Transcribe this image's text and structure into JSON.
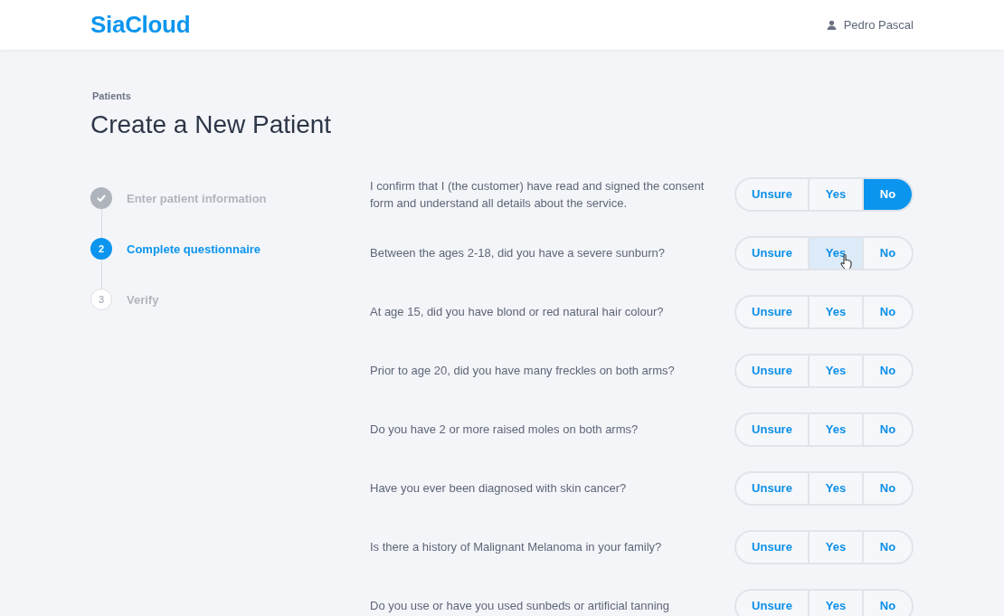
{
  "header": {
    "logo": "SiaCloud",
    "user": "Pedro Pascal"
  },
  "breadcrumb": "Patients",
  "title": "Create a New Patient",
  "steps": [
    {
      "label": "Enter patient information",
      "kind": "done"
    },
    {
      "marker": "2",
      "label": "Complete questionnaire",
      "kind": "current"
    },
    {
      "marker": "3",
      "label": "Verify",
      "kind": "pending"
    }
  ],
  "questions": [
    {
      "text": "I confirm that I (the customer) have read and signed the consent form and understand all details about the service.",
      "options": [
        {
          "label": "Unsure",
          "selected": false,
          "hovered": false
        },
        {
          "label": "Yes",
          "selected": false,
          "hovered": false
        },
        {
          "label": "No",
          "selected": true,
          "hovered": false
        }
      ]
    },
    {
      "text": "Between the ages 2-18, did you have a severe sunburn?",
      "options": [
        {
          "label": "Unsure",
          "selected": false,
          "hovered": false
        },
        {
          "label": "Yes",
          "selected": false,
          "hovered": true
        },
        {
          "label": "No",
          "selected": false,
          "hovered": false
        }
      ]
    },
    {
      "text": "At age 15, did you have blond or red natural hair colour?",
      "options": [
        {
          "label": "Unsure",
          "selected": false,
          "hovered": false
        },
        {
          "label": "Yes",
          "selected": false,
          "hovered": false
        },
        {
          "label": "No",
          "selected": false,
          "hovered": false
        }
      ]
    },
    {
      "text": "Prior to age 20, did you have many freckles on both arms?",
      "options": [
        {
          "label": "Unsure",
          "selected": false,
          "hovered": false
        },
        {
          "label": "Yes",
          "selected": false,
          "hovered": false
        },
        {
          "label": "No",
          "selected": false,
          "hovered": false
        }
      ]
    },
    {
      "text": "Do you have 2 or more raised moles on both arms?",
      "options": [
        {
          "label": "Unsure",
          "selected": false,
          "hovered": false
        },
        {
          "label": "Yes",
          "selected": false,
          "hovered": false
        },
        {
          "label": "No",
          "selected": false,
          "hovered": false
        }
      ]
    },
    {
      "text": "Have you ever been diagnosed with skin cancer?",
      "options": [
        {
          "label": "Unsure",
          "selected": false,
          "hovered": false
        },
        {
          "label": "Yes",
          "selected": false,
          "hovered": false
        },
        {
          "label": "No",
          "selected": false,
          "hovered": false
        }
      ]
    },
    {
      "text": "Is there a history of Malignant Melanoma in your family?",
      "options": [
        {
          "label": "Unsure",
          "selected": false,
          "hovered": false
        },
        {
          "label": "Yes",
          "selected": false,
          "hovered": false
        },
        {
          "label": "No",
          "selected": false,
          "hovered": false
        }
      ]
    },
    {
      "text": "Do you use or have you used sunbeds or artificial tanning",
      "options": [
        {
          "label": "Unsure",
          "selected": false,
          "hovered": false
        },
        {
          "label": "Yes",
          "selected": false,
          "hovered": false
        },
        {
          "label": "No",
          "selected": false,
          "hovered": false
        }
      ]
    }
  ]
}
